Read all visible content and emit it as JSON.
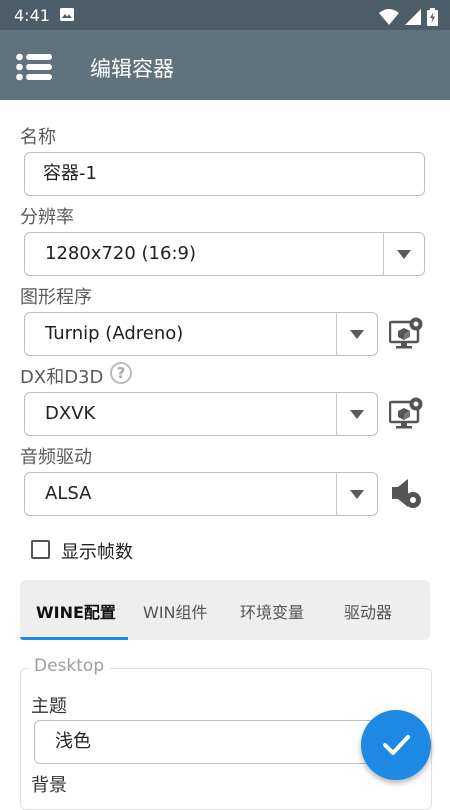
{
  "status_bar": {
    "time": "4:41",
    "icons": [
      "gallery-icon",
      "wifi-icon",
      "signal-icon",
      "battery-charging-icon"
    ]
  },
  "app_bar": {
    "title": "编辑容器",
    "menu_icon": "menu-icon"
  },
  "form": {
    "name_label": "名称",
    "name_value": "容器-1",
    "resolution_label": "分辨率",
    "resolution_value": "1280x720 (16:9)",
    "graphics_label": "图形程序",
    "graphics_value": "Turnip (Adreno)",
    "dx_label": "DX和D3D",
    "dx_help_glyph": "?",
    "dx_value": "DXVK",
    "audio_label": "音频驱动",
    "audio_value": "ALSA",
    "show_fps_label": "显示帧数",
    "show_fps_checked": false
  },
  "tabs": [
    {
      "label": "WINE配置",
      "active": true
    },
    {
      "label": "WIN组件",
      "active": false
    },
    {
      "label": "环境变量",
      "active": false
    },
    {
      "label": "驱动器",
      "active": false
    }
  ],
  "desktop": {
    "legend": "Desktop",
    "theme_label": "主题",
    "theme_value": "浅色",
    "background_label": "背景"
  },
  "colors": {
    "status_bar": "#4b5d66",
    "app_bar": "#5e737d",
    "accent": "#1e88e5"
  }
}
